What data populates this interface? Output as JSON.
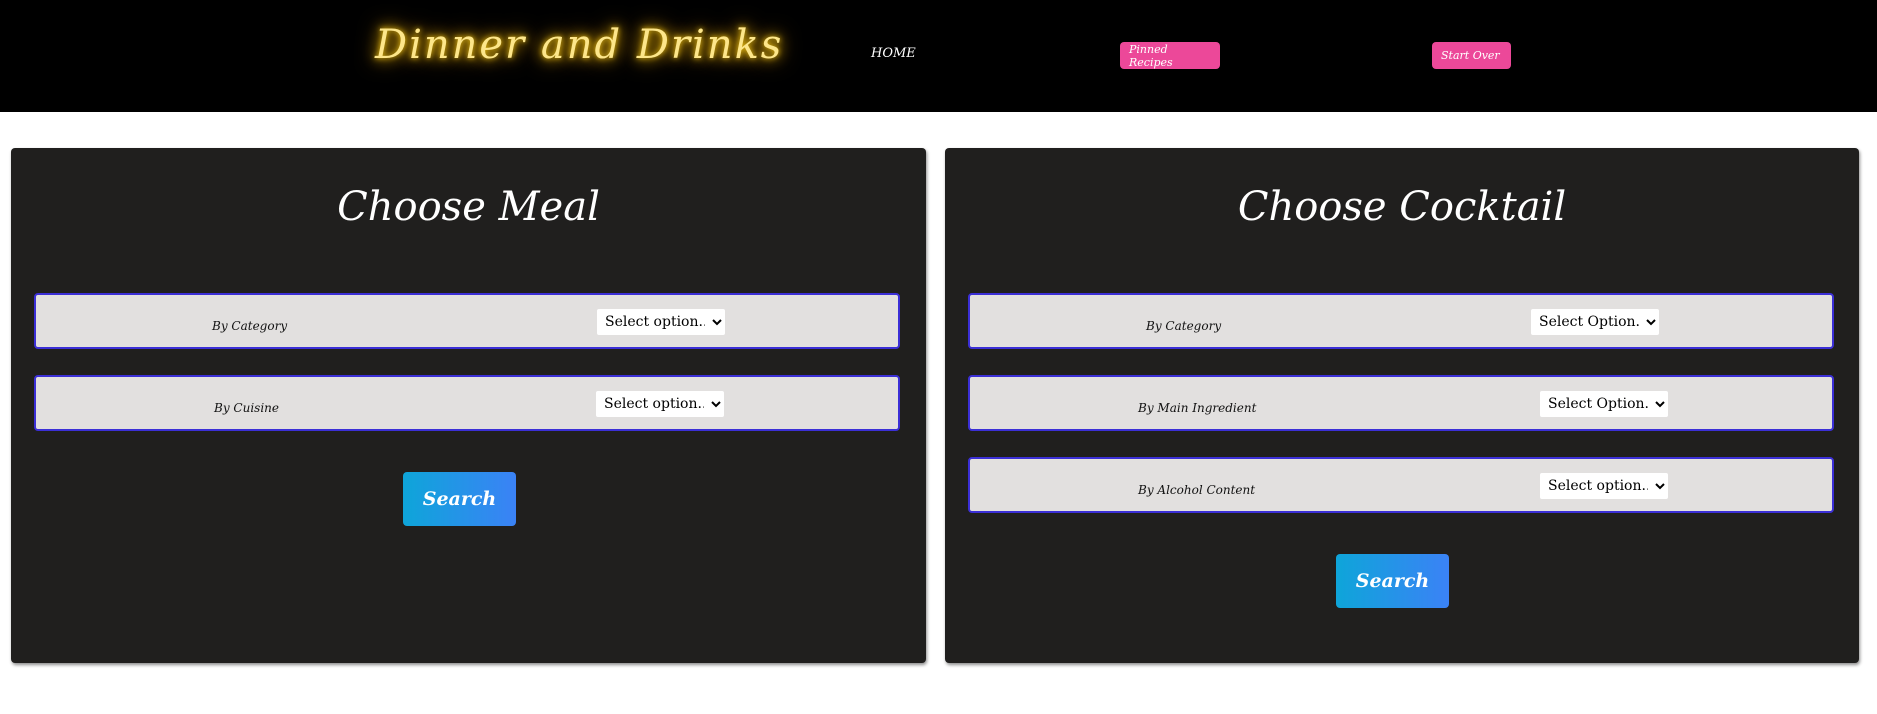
{
  "navbar": {
    "logo_text": "Dinner and Drinks",
    "home_label": "HOME",
    "pinned_label": "Pinned Recipes",
    "start_over_label": "Start Over"
  },
  "meal": {
    "title": "Choose Meal",
    "category_label": "By Category",
    "category_value": "Select option...",
    "cuisine_label": "By Cuisine",
    "cuisine_value": "Select option...",
    "search_label": "Search"
  },
  "cocktail": {
    "title": "Choose Cocktail",
    "category_label": "By Category",
    "category_value": "Select Option...",
    "ingredient_label": "By Main Ingredient",
    "ingredient_value": "Select Option...",
    "alcohol_label": "By Alcohol Content",
    "alcohol_value": "Select option...",
    "search_label": "Search"
  },
  "colors": {
    "navbar": "#000000",
    "logo_glow": "#fde68a",
    "nav_button": "#ec4899",
    "panel": "#201f1e",
    "filter_row": "#e2e0df",
    "filter_border": "#3b2fd6",
    "search_gradient_start": "#0ea5d9",
    "search_gradient_end": "#3b82f6"
  }
}
